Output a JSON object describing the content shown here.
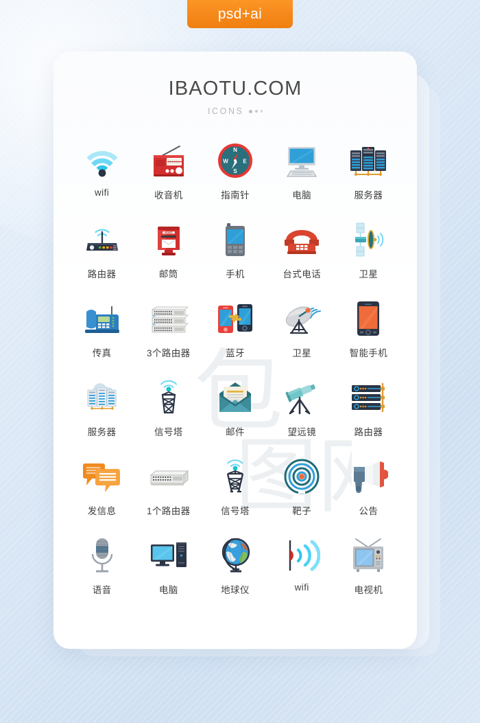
{
  "badge": {
    "label": "psd+ai",
    "color": "#f5881a"
  },
  "card": {
    "title": "IBAOTU.COM",
    "subtitle": "ICONS"
  },
  "palette": {
    "accent_orange": "#f5881a",
    "wifi_cyan": "#6fd8f5",
    "wifi_cyan_light": "#a9e7f8",
    "dark_navy": "#2b3444",
    "red": "#d32f2f",
    "teal": "#2a6f7c",
    "blue": "#2f9fd8",
    "slate": "#5b7b93",
    "label_gray": "#3f3f3f",
    "title_gray": "#4a4a4a",
    "subtitle_gray": "#b5b5b5"
  },
  "icons": [
    {
      "label": "wifi",
      "name": "wifi-icon"
    },
    {
      "label": "收音机",
      "name": "radio-icon"
    },
    {
      "label": "指南针",
      "name": "compass-icon"
    },
    {
      "label": "电脑",
      "name": "desktop-computer-icon"
    },
    {
      "label": "服务器",
      "name": "server-rack-icon"
    },
    {
      "label": "路由器",
      "name": "router-icon"
    },
    {
      "label": "邮筒",
      "name": "mailbox-icon"
    },
    {
      "label": "手机",
      "name": "mobile-phone-icon"
    },
    {
      "label": "台式电话",
      "name": "desk-telephone-icon"
    },
    {
      "label": "卫星",
      "name": "satellite-icon"
    },
    {
      "label": "传真",
      "name": "fax-machine-icon"
    },
    {
      "label": "3个路由器",
      "name": "three-routers-icon"
    },
    {
      "label": "蓝牙",
      "name": "bluetooth-transfer-icon"
    },
    {
      "label": "卫星",
      "name": "satellite-dish-icon"
    },
    {
      "label": "智能手机",
      "name": "smartphone-icon"
    },
    {
      "label": "服务器",
      "name": "cloud-server-icon"
    },
    {
      "label": "信号塔",
      "name": "signal-tower-icon"
    },
    {
      "label": "邮件",
      "name": "mail-envelope-icon"
    },
    {
      "label": "望远镜",
      "name": "telescope-icon"
    },
    {
      "label": "路由器",
      "name": "server-router-icon"
    },
    {
      "label": "发信息",
      "name": "send-message-icon"
    },
    {
      "label": "1个路由器",
      "name": "one-router-icon"
    },
    {
      "label": "信号塔",
      "name": "transmission-tower-icon"
    },
    {
      "label": "靶子",
      "name": "target-icon"
    },
    {
      "label": "公告",
      "name": "megaphone-icon"
    },
    {
      "label": "语音",
      "name": "microphone-icon"
    },
    {
      "label": "电脑",
      "name": "pc-tower-icon"
    },
    {
      "label": "地球仪",
      "name": "globe-icon"
    },
    {
      "label": "wifi",
      "name": "wifi-signal-icon"
    },
    {
      "label": "电视机",
      "name": "television-icon"
    }
  ]
}
